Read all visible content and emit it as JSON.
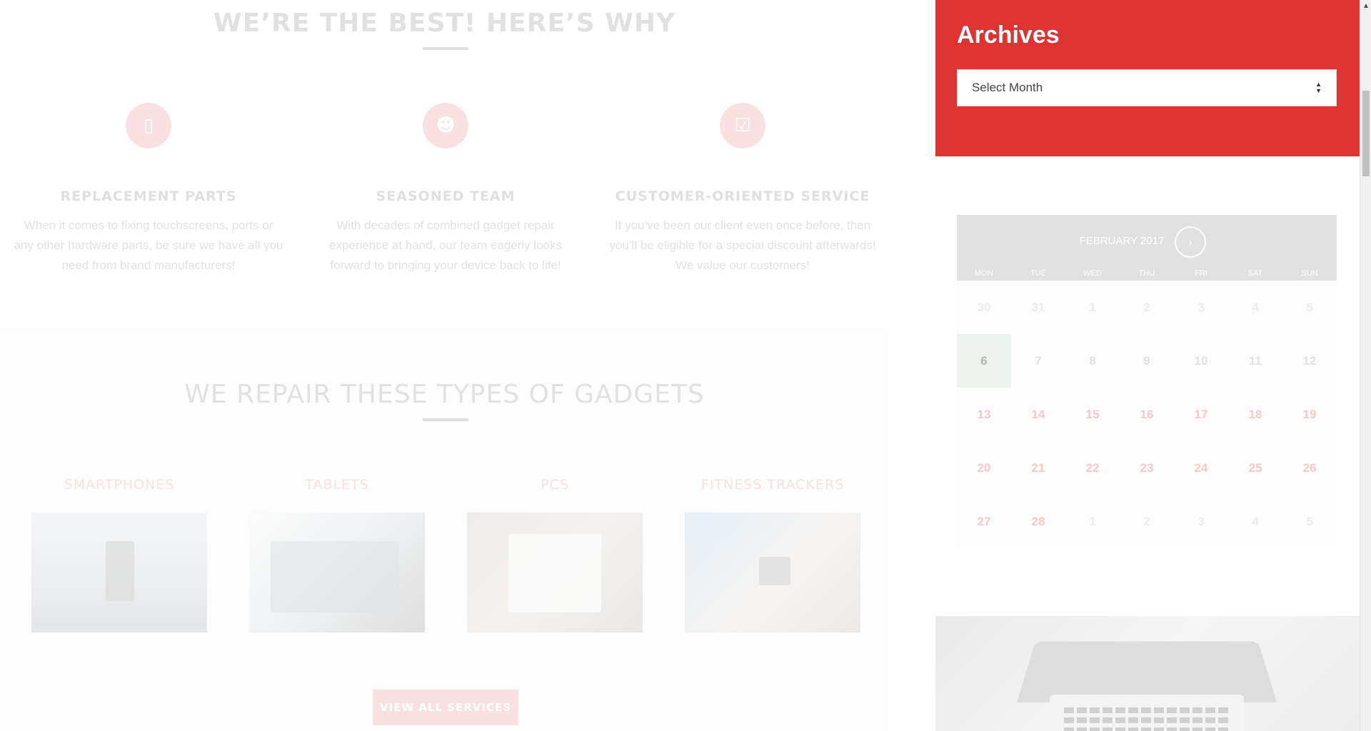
{
  "why": {
    "title": "WE’RE THE BEST! HERE’S WHY",
    "features": [
      {
        "icon": "smartphone-icon",
        "title": "REPLACEMENT PARTS",
        "text": "When it comes to fixing touchscreens, ports or any other hardware parts, be sure we have all you need from brand manufacturers!"
      },
      {
        "icon": "team-icon",
        "title": "SEASONED TEAM",
        "text": "With decades of combined gadget repair experience at hand, our team eagerly looks forward to bringing your device back to life!"
      },
      {
        "icon": "checkbox-icon",
        "title": "CUSTOMER-ORIENTED SERVICE",
        "text": "If you’ve been our client even once before, then you’ll be eligible for a special discount afterwards! We value our customers!"
      }
    ]
  },
  "gadgets": {
    "title": "WE REPAIR THESE TYPES OF GADGETS",
    "items": [
      {
        "name": "SMARTPHONES"
      },
      {
        "name": "TABLETS"
      },
      {
        "name": "PCS"
      },
      {
        "name": "FITNESS TRACKERS"
      }
    ],
    "view_all": "VIEW ALL SERVICES"
  },
  "sidebar": {
    "archives_title": "Archives",
    "select_value": "Select Month",
    "calendar": {
      "month": "FEBRUARY 2017",
      "next": "›",
      "weekdays": [
        "MON",
        "TUE",
        "WED",
        "THU",
        "FRI",
        "SAT",
        "SUN"
      ],
      "weeks": [
        [
          "30",
          "31",
          "1",
          "2",
          "3",
          "4",
          "5"
        ],
        [
          "6",
          "7",
          "8",
          "9",
          "10",
          "11",
          "12"
        ],
        [
          "13",
          "14",
          "15",
          "16",
          "17",
          "18",
          "19"
        ],
        [
          "20",
          "21",
          "22",
          "23",
          "24",
          "25",
          "26"
        ],
        [
          "27",
          "28",
          "1",
          "2",
          "3",
          "4",
          "5"
        ]
      ]
    }
  },
  "colors": {
    "accent": "#dd3333",
    "calendar_header": "#e1e1e1"
  }
}
